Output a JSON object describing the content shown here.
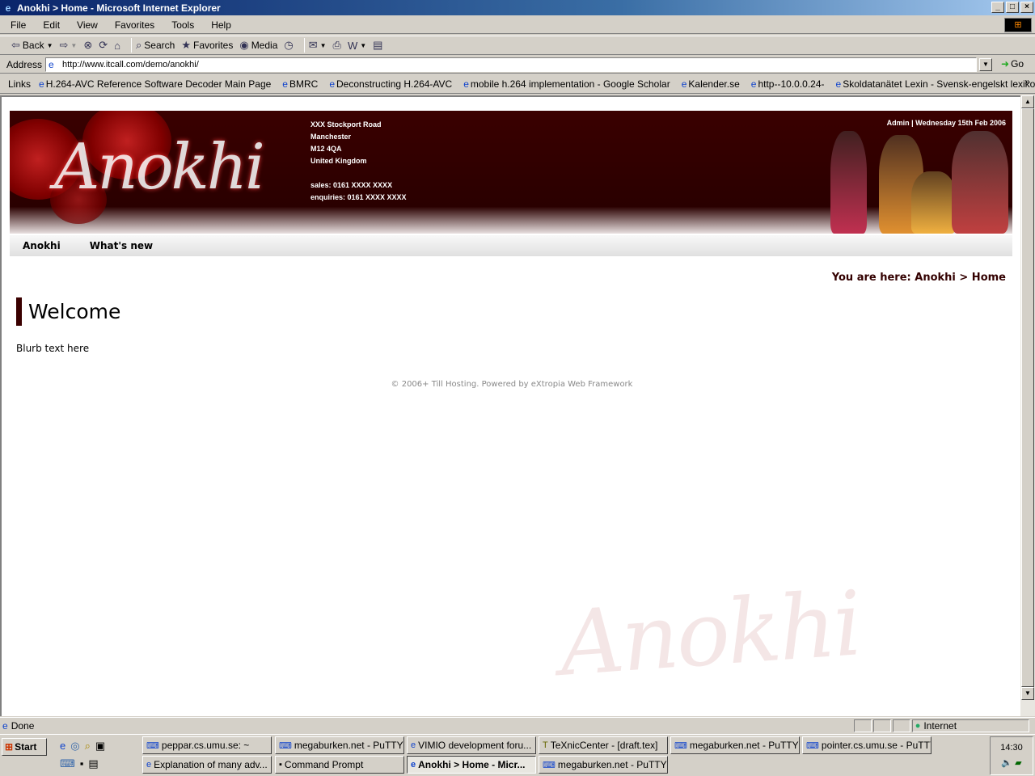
{
  "window": {
    "title": "Anokhi > Home - Microsoft Internet Explorer"
  },
  "menu": [
    "File",
    "Edit",
    "View",
    "Favorites",
    "Tools",
    "Help"
  ],
  "toolbar": {
    "back": "Back",
    "search": "Search",
    "favorites": "Favorites",
    "media": "Media"
  },
  "address": {
    "label": "Address",
    "url": "http://www.itcall.com/demo/anokhi/",
    "go": "Go"
  },
  "links": {
    "label": "Links",
    "items": [
      "H.264-AVC Reference Software Decoder Main Page",
      "BMRC",
      "Deconstructing H.264-AVC",
      "mobile h.264 implementation - Google Scholar",
      "Kalender.se",
      "http--10.0.0.24-",
      "Skoldatanätet Lexin - Svensk-engelskt lexikon"
    ]
  },
  "page": {
    "logo": "Anokhi",
    "address_lines": [
      "XXX Stockport Road",
      "Manchester",
      "M12 4QA",
      "United Kingdom"
    ],
    "sales": "sales: 0161 XXXX XXXX",
    "enquiries": "enquiries: 0161 XXXX XXXX",
    "admin": "Admin | Wednesday 15th Feb 2006",
    "nav": [
      "Anokhi",
      "What's new"
    ],
    "breadcrumb": "You are here: Anokhi > Home",
    "heading": "Welcome",
    "blurb": "Blurb text here",
    "footer": "© 2006+ Till Hosting. Powered by eXtropia Web Framework",
    "watermark": "Anokhi"
  },
  "status": {
    "text": "Done",
    "zone": "Internet"
  },
  "taskbar": {
    "start": "Start",
    "row1": [
      "peppar.cs.umu.se: ~",
      "megaburken.net - PuTTY",
      "VIMIO development foru...",
      "TeXnicCenter - [draft.tex]",
      "megaburken.net - PuTTY",
      "pointer.cs.umu.se - PuTTY"
    ],
    "row2": [
      "Explanation of many adv...",
      "Command Prompt",
      "Anokhi > Home - Micr...",
      "megaburken.net - PuTTY"
    ],
    "clock": "14:30"
  }
}
